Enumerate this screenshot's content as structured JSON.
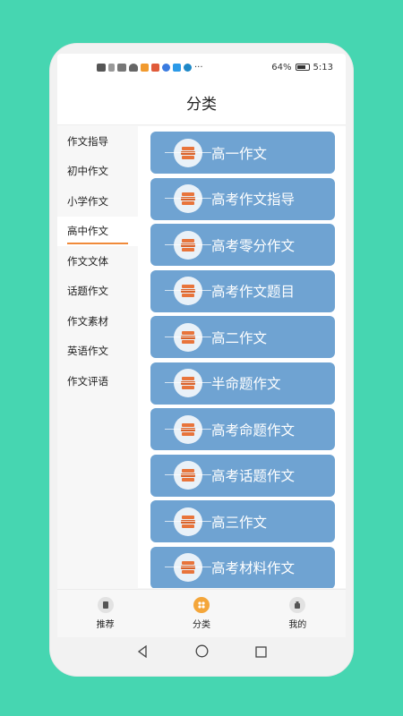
{
  "status_bar": {
    "battery": "64%",
    "time": "5:13",
    "more": "···"
  },
  "header": {
    "title": "分类"
  },
  "sidebar": {
    "items": [
      {
        "label": "作文指导",
        "active": false
      },
      {
        "label": "初中作文",
        "active": false
      },
      {
        "label": "小学作文",
        "active": false
      },
      {
        "label": "高中作文",
        "active": true
      },
      {
        "label": "作文文体",
        "active": false
      },
      {
        "label": "话题作文",
        "active": false
      },
      {
        "label": "作文素材",
        "active": false
      },
      {
        "label": "英语作文",
        "active": false
      },
      {
        "label": "作文评语",
        "active": false
      }
    ]
  },
  "categories": [
    {
      "label": "高一作文"
    },
    {
      "label": "高考作文指导"
    },
    {
      "label": "高考零分作文"
    },
    {
      "label": "高考作文题目"
    },
    {
      "label": "高二作文"
    },
    {
      "label": "半命题作文"
    },
    {
      "label": "高考命题作文"
    },
    {
      "label": "高考话题作文"
    },
    {
      "label": "高三作文"
    },
    {
      "label": "高考材料作文"
    }
  ],
  "tabbar": {
    "items": [
      {
        "label": "推荐",
        "icon": "book-icon",
        "active": false
      },
      {
        "label": "分类",
        "icon": "grid-icon",
        "active": true
      },
      {
        "label": "我的",
        "icon": "user-icon",
        "active": false
      }
    ]
  },
  "colors": {
    "background": "#46d6b1",
    "category_card": "#6fa3d2",
    "accent": "#f08a3a"
  }
}
